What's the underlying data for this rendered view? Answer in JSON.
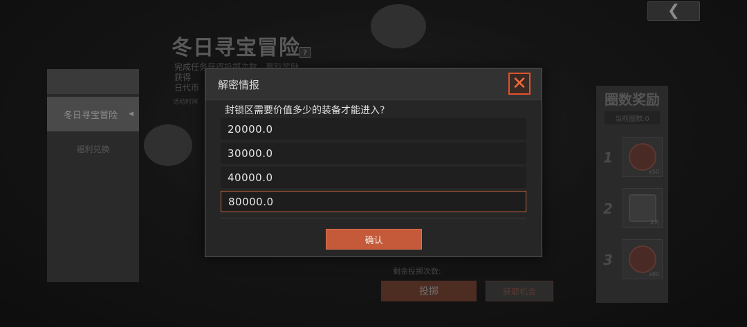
{
  "background": {
    "event_title": "冬日寻宝冒险",
    "event_desc_lines": [
      "完成任务获得投掷次数，赢取奖励",
      "获得",
      "日代币"
    ],
    "event_note": "活动时间",
    "help_label": "?",
    "left_menu": [
      {
        "label": "冬日寻宝冒险",
        "active": true
      },
      {
        "label": "福利兑换",
        "active": false
      }
    ],
    "reward_panel": {
      "title": "圈数奖励",
      "subtitle": "当前圈数:0",
      "tiers": [
        {
          "num": "1",
          "qty": "x50"
        },
        {
          "num": "2",
          "qty": "3天"
        },
        {
          "num": "3",
          "qty": "x80"
        }
      ]
    },
    "mid_note": "剩余投掷次数:",
    "claim_label": "投掷",
    "chance_label": "获取机会"
  },
  "modal": {
    "title": "解密情报",
    "question": "封锁区需要价值多少的装备才能进入?",
    "options": [
      "20000.0",
      "30000.0",
      "40000.0",
      "80000.0"
    ],
    "selected_index": 3,
    "confirm_label": "确认"
  },
  "colors": {
    "accent": "#c55a3a",
    "close_border": "#e0522c"
  }
}
